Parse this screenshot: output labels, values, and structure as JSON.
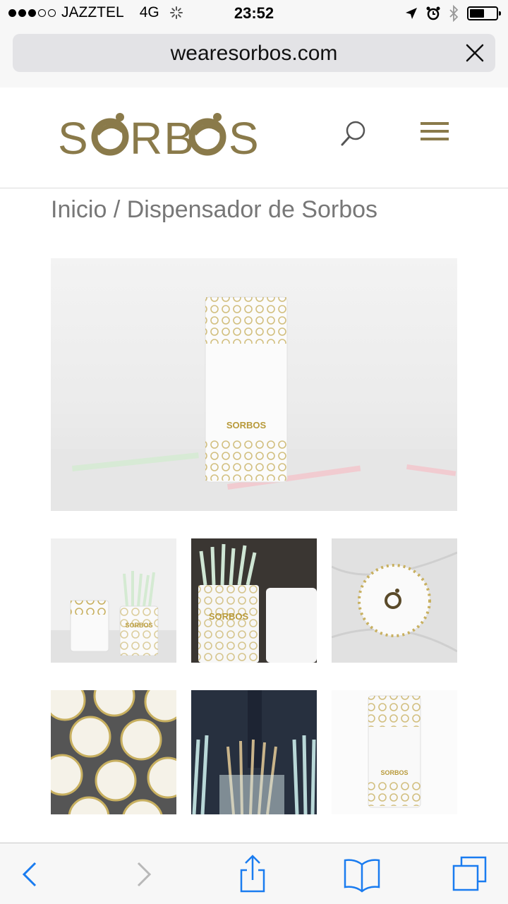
{
  "status_bar": {
    "carrier": "JAZZTEL",
    "network": "4G",
    "time": "23:52",
    "battery_level": 0.55
  },
  "browser": {
    "url": "wearesorbos.com"
  },
  "site": {
    "logo_text": "SORBOS",
    "brand_color": "#8a7a4a"
  },
  "breadcrumb": "Inicio / Dispensador de Sorbos",
  "gallery": {
    "hero_label": "SORBOS",
    "thumb2_label": "SORBOS",
    "thumb1_label": "SORBOS",
    "thumb6_label": "SORBOS"
  },
  "toolbar": {
    "icons": [
      "back-icon",
      "forward-icon",
      "share-icon",
      "bookmarks-icon",
      "tabs-icon"
    ],
    "accent": "#1a7cf0"
  }
}
